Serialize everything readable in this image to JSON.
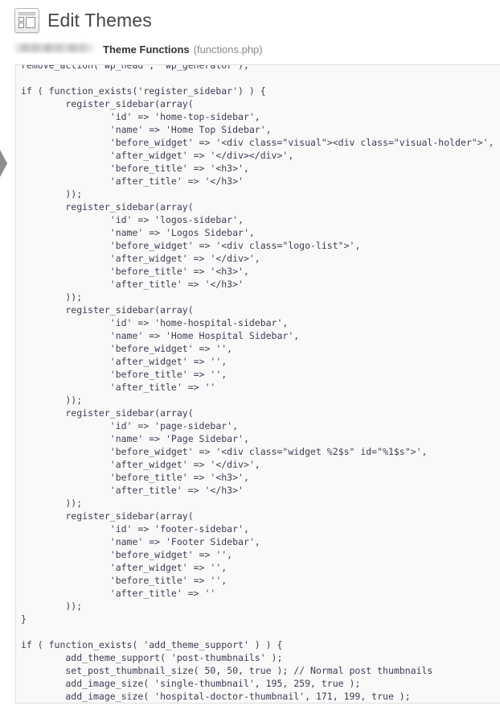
{
  "header": {
    "title": "Edit Themes",
    "icon": "appearance-theme-icon"
  },
  "file_bar": {
    "theme_name": "",
    "file_title": "Theme Functions",
    "file_name": "(functions.php)"
  },
  "sidebar_toggle": {
    "icon": "chevron-right-icon"
  },
  "editor": {
    "language": "php",
    "code": "remove_action('wp_head', 'wp_generator');\n\nif ( function_exists('register_sidebar') ) {\n        register_sidebar(array(\n                'id' => 'home-top-sidebar',\n                'name' => 'Home Top Sidebar',\n                'before_widget' => '<div class=\"visual\"><div class=\"visual-holder\">',\n                'after_widget' => '</div></div>',\n                'before_title' => '<h3>',\n                'after_title' => '</h3>'\n        ));\n        register_sidebar(array(\n                'id' => 'logos-sidebar',\n                'name' => 'Logos Sidebar',\n                'before_widget' => '<div class=\"logo-list\">',\n                'after_widget' => '</div>',\n                'before_title' => '<h3>',\n                'after_title' => '</h3>'\n        ));\n        register_sidebar(array(\n                'id' => 'home-hospital-sidebar',\n                'name' => 'Home Hospital Sidebar',\n                'before_widget' => '',\n                'after_widget' => '',\n                'before_title' => '',\n                'after_title' => ''\n        ));\n        register_sidebar(array(\n                'id' => 'page-sidebar',\n                'name' => 'Page Sidebar',\n                'before_widget' => '<div class=\"widget %2$s\" id=\"%1$s\">',\n                'after_widget' => '</div>',\n                'before_title' => '<h3>',\n                'after_title' => '</h3>'\n        ));\n        register_sidebar(array(\n                'id' => 'footer-sidebar',\n                'name' => 'Footer Sidebar',\n                'before_widget' => '',\n                'after_widget' => '',\n                'before_title' => '',\n                'after_title' => ''\n        ));\n}\n\nif ( function_exists( 'add_theme_support' ) ) {\n        add_theme_support( 'post-thumbnails' );\n        set_post_thumbnail_size( 50, 50, true ); // Normal post thumbnails\n        add_image_size( 'single-thumbnail', 195, 259, true );\n        add_image_size( 'hospital-doctor-thumbnail', 171, 199, true );"
  },
  "colors": {
    "page_background": "#ffffff",
    "editor_background": "#f9f9f9",
    "editor_border": "#dfdfdf",
    "code_text": "#3c3c55",
    "title_text": "#464646",
    "muted_text": "#888888"
  }
}
